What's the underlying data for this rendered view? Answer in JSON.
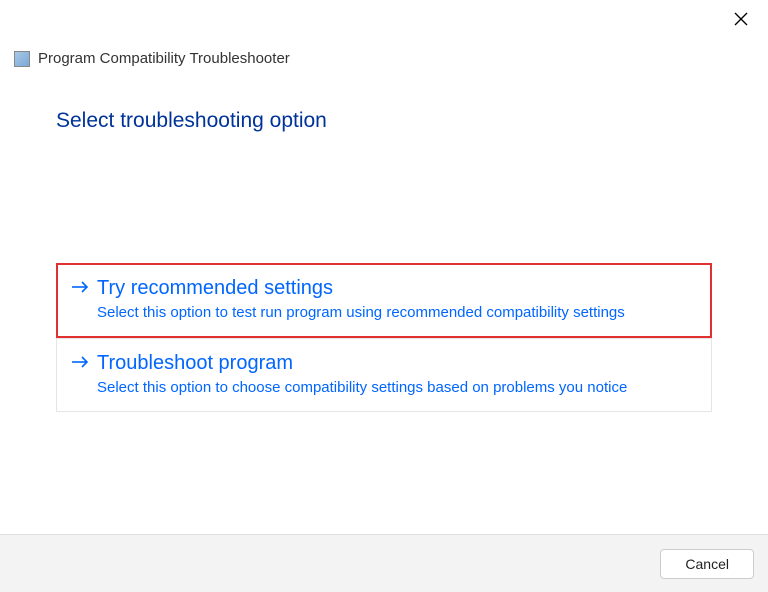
{
  "window": {
    "app_title": "Program Compatibility Troubleshooter"
  },
  "content": {
    "heading": "Select troubleshooting option",
    "options": [
      {
        "title": "Try recommended settings",
        "description": "Select this option to test run program using recommended compatibility settings"
      },
      {
        "title": "Troubleshoot program",
        "description": "Select this option to choose compatibility settings based on problems you notice"
      }
    ]
  },
  "footer": {
    "cancel_label": "Cancel"
  },
  "colors": {
    "heading": "#003399",
    "link": "#0066ff",
    "highlight_border": "#e03030"
  }
}
